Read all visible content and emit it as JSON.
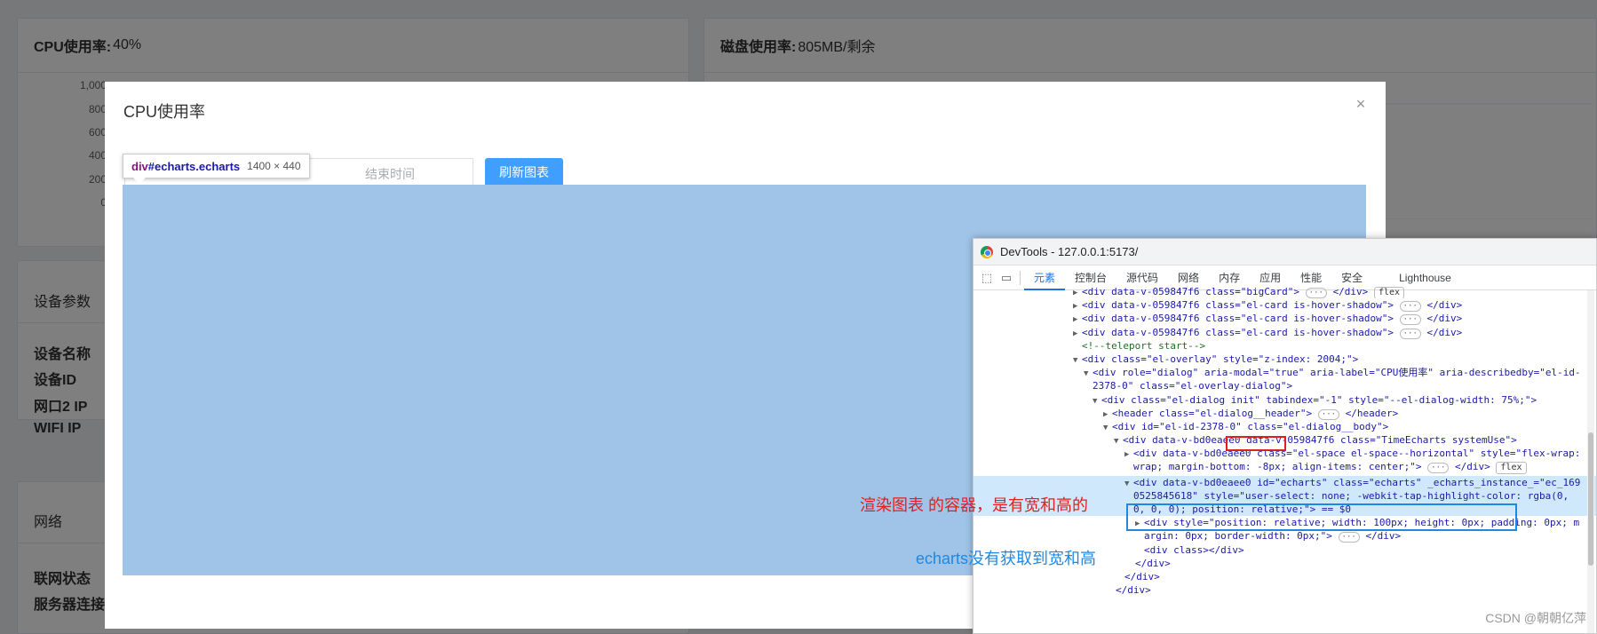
{
  "background": {
    "cpu_card": {
      "title": "CPU使用率:",
      "value": "40%",
      "y_ticks": [
        "1,000",
        "800",
        "600",
        "400",
        "200",
        "0"
      ]
    },
    "disk_card": {
      "title": "磁盘使用率:",
      "value": "805MB/剩余"
    },
    "device_card": {
      "title": "设备参数",
      "fields": [
        "设备名称",
        "设备ID",
        "网口2 IP",
        "WIFI IP"
      ]
    },
    "network_card": {
      "title": "网络",
      "fields": [
        "联网状态",
        "服务器连接"
      ]
    }
  },
  "dialog": {
    "title": "CPU使用率",
    "close_icon": "×",
    "end_time_placeholder": "结束时间",
    "refresh_label": "刷新图表"
  },
  "tooltip": {
    "tag": "div",
    "selector": "#echarts.echarts",
    "size": "1400 × 440"
  },
  "devtools": {
    "window_title": "DevTools - 127.0.0.1:5173/",
    "tabs": [
      "元素",
      "控制台",
      "源代码",
      "网络",
      "内存",
      "应用",
      "性能",
      "安全",
      "Lighthouse"
    ],
    "lines": [
      "<div data-v-059847f6 class=\"bigCard\">",
      "<div data-v-059847f6 class=\"el-card is-hover-shadow\">",
      "<div data-v-059847f6 class=\"el-card is-hover-shadow\">",
      "<div data-v-059847f6 class=\"el-card is-hover-shadow\">",
      "<!--teleport start-->",
      "<div class=\"el-overlay\" style=\"z-index: 2004;\">",
      "<div role=\"dialog\" aria-modal=\"true\" aria-label=\"CPU使用率\" aria-describedby=\"el-id-",
      "2378-0\" class=\"el-overlay-dialog\">",
      "<div class=\"el-dialog init\" tabindex=\"-1\" style=\"--el-dialog-width: 75%;\">",
      "<header class=\"el-dialog__header\">",
      "<div id=\"el-id-2378-0\" class=\"el-dialog__body\">",
      "<div data-v-bd0eaee0 data-v-059847f6 class=\"TimeEcharts systemUse\">",
      "<div data-v-bd0eaee0 class=\"el-space el-space--horizontal\" style=\"flex-wrap:",
      "wrap; margin-bottom: -8px; align-items: center;\">",
      "<div data-v-bd0eaee0 id=\"echarts\" class=\"echarts\" _echarts_instance_=\"ec_169",
      "0525845618\" style=\"user-select: none; -webkit-tap-highlight-color: rgba(0,",
      "0, 0, 0); position: relative;\"> == $0",
      "<div style=\"position: relative; width: 100px; height: 0px; padding: 0px; m",
      "argin: 0px; border-width: 0px;\">",
      "<div class></div>",
      "</div>",
      "</div>",
      "</div>"
    ],
    "badge_flex": "flex",
    "ellipsis": "···",
    "close_div": "</div>",
    "close_header": "</header>",
    "dollar_ref": "== $0"
  },
  "annotations": {
    "red": "渲染图表 的容器，是有宽和高的",
    "blue": "echarts没有获取到宽和高"
  },
  "watermark": "CSDN @朝朝亿萍",
  "colors": {
    "primary": "#409eff",
    "overlay": "rgba(0,0,0,0.5)",
    "selection": "#a0c4e8",
    "annot_red": "#e02020",
    "annot_blue": "#1e88e5"
  }
}
